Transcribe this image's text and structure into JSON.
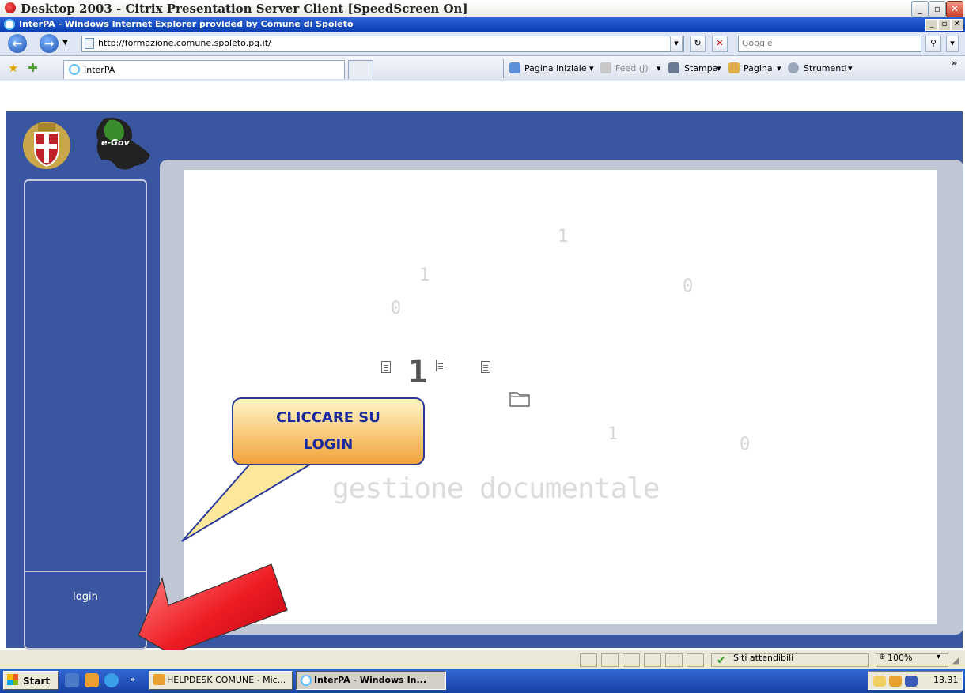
{
  "citrix_window": {
    "title": "Desktop 2003 - Citrix Presentation Server Client [SpeedScreen On]"
  },
  "browser_window": {
    "title": "InterPA - Windows Internet Explorer provided by Comune di Spoleto"
  },
  "address_bar": {
    "url": "http://formazione.comune.spoleto.pg.it/",
    "search_placeholder": "Google"
  },
  "tabs": [
    {
      "label": "InterPA"
    }
  ],
  "command_bar": {
    "home": "Pagina iniziale",
    "feed": "Feed (J)",
    "print": "Stampa",
    "page": "Pagina",
    "tools": "Strumenti",
    "chevron": "»"
  },
  "page": {
    "logo_text": "e-Gov",
    "login_label": "login",
    "background_digits": [
      "1",
      "1",
      "0",
      "0",
      "1",
      "1",
      "0"
    ],
    "banner_text": "gestione documentale"
  },
  "callout": {
    "line1": "CLICCARE SU",
    "line2": "LOGIN"
  },
  "status_bar": {
    "zone": "Siti attendibili",
    "zoom": "100%"
  },
  "taskbar": {
    "start_label": "Start",
    "chevron": "»",
    "buttons": [
      {
        "label": "HELPDESK COMUNE - Mic..."
      },
      {
        "label": "InterPA - Windows In..."
      }
    ],
    "clock": "13.31"
  },
  "colors": {
    "page_blue": "#3b56a0",
    "arrow_red": "#e8131b",
    "callout_text": "#1a2a9a"
  }
}
